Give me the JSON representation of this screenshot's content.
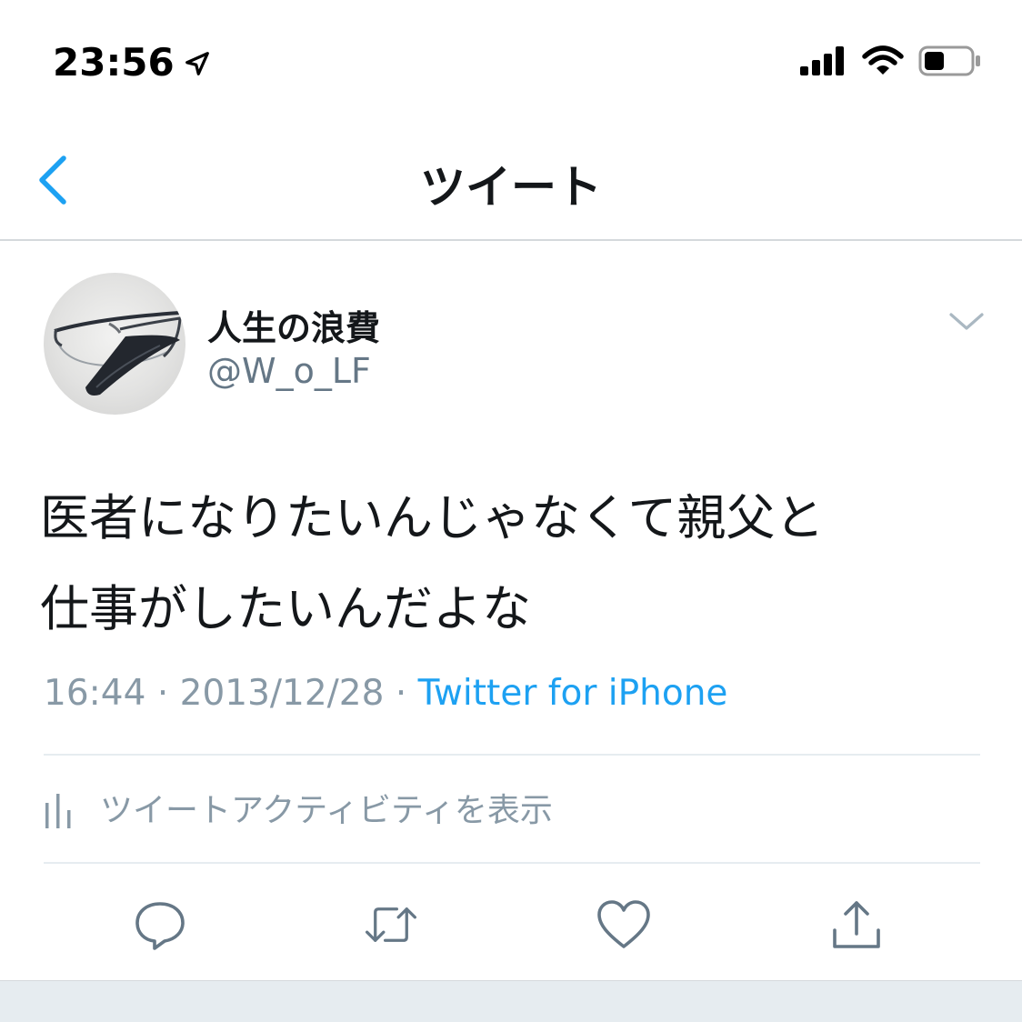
{
  "status_bar": {
    "time": "23:56",
    "location_icon": "location-arrow-icon",
    "signal_icon": "cellular-signal-icon",
    "wifi_icon": "wifi-icon",
    "battery_icon": "battery-icon",
    "battery_level": 0.35
  },
  "nav": {
    "back_icon": "chevron-left-icon",
    "title": "ツイート"
  },
  "tweet": {
    "display_name": "人生の浪費",
    "handle": "@W_o_LF",
    "avatar_icon": "eyeglasses-avatar",
    "menu_icon": "chevron-down-icon",
    "text_line1": "医者になりたいんじゃなくて親父と",
    "text_line2": "仕事がしたいんだよな",
    "time": "16:44",
    "separator": "·",
    "date": "2013/12/28",
    "source": "Twitter for iPhone"
  },
  "activity": {
    "icon": "bar-chart-icon",
    "label": "ツイートアクティビティを表示"
  },
  "actions": [
    {
      "name": "reply",
      "icon": "reply-icon"
    },
    {
      "name": "retweet",
      "icon": "retweet-icon"
    },
    {
      "name": "like",
      "icon": "heart-icon"
    },
    {
      "name": "share",
      "icon": "share-icon"
    }
  ],
  "colors": {
    "accent": "#1da1f2",
    "secondary_text": "#8899a6",
    "icon_gray": "#657786",
    "divider": "#e6ecf0"
  }
}
